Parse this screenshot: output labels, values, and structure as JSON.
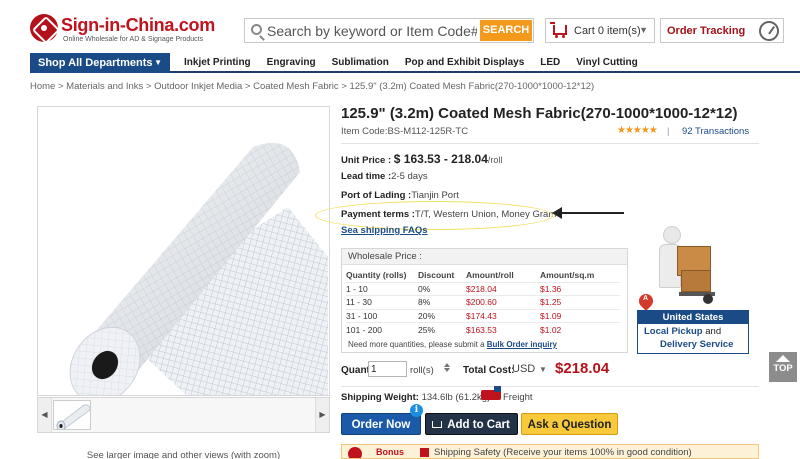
{
  "header": {
    "logo_name": "Sign-in-China.com",
    "logo_tagline": "Online Wholesale for AD & Signage Products",
    "search_placeholder": "Search by keyword or Item Code#",
    "search_button": "SEARCH",
    "cart_label": "Cart 0 item(s)",
    "order_tracking": "Order Tracking"
  },
  "nav": {
    "departments": "Shop All Departments",
    "items": [
      "Inkjet Printing",
      "Engraving",
      "Sublimation",
      "Pop and Exhibit Displays",
      "LED",
      "Vinyl Cutting"
    ]
  },
  "breadcrumb": "Home > Materials and Inks > Outdoor Inkjet Media > Coated Mesh Fabric > 125.9\" (3.2m) Coated Mesh Fabric(270-1000*1000-12*12)",
  "gallery": {
    "caption": "See larger image and other views (with zoom)"
  },
  "product": {
    "title": "125.9\" (3.2m) Coated Mesh Fabric(270-1000*1000-12*12)",
    "item_code": "Item Code:BS-M112-125R-TC",
    "rating_stars": "★★★★★",
    "separator": "|",
    "transactions": "92 Transactions",
    "unit_price_label": "Unit Price :",
    "unit_price_value": "$ 163.53 - 218.04",
    "unit_price_unit": "/roll",
    "lead_time_label": "Lead time :",
    "lead_time_value": "2-5 days",
    "port_label": "Port of Lading :",
    "port_value": "Tianjin Port",
    "payment_label": "Payment terms :",
    "payment_value": "T/T, Western Union, Money Gram",
    "shipping_faqs": "Sea shipping FAQs"
  },
  "wholesale": {
    "heading": "Wholesale Price :",
    "columns": [
      "Quantity (rolls)",
      "Discount",
      "Amount/roll",
      "Amount/sq.m"
    ],
    "rows": [
      [
        "1 - 10",
        "0%",
        "$218.04",
        "$1.36"
      ],
      [
        "11 - 30",
        "8%",
        "$200.60",
        "$1.25"
      ],
      [
        "31 - 100",
        "20%",
        "$174.43",
        "$1.09"
      ],
      [
        "101 - 200",
        "25%",
        "$163.53",
        "$1.02"
      ]
    ],
    "note": "Need more quantities, please submit a",
    "note_link": "Bulk Order inquiry"
  },
  "delivery": {
    "pin_label": "A",
    "country": "United States",
    "line1_a": "Local Pickup",
    "line1_b": "and",
    "line2": "Delivery Service"
  },
  "purchase": {
    "quantity_label": "Quantity:",
    "quantity_value": "1",
    "quantity_unit": "roll(s)",
    "total_label": "Total Cost:",
    "currency": "USD",
    "total_value": "$218.04",
    "ship_weight_label": "Shipping Weight:",
    "ship_weight_value": "134.6lb (61.2kg)",
    "freight_label": "Freight",
    "order_now": "Order Now",
    "add_to_cart": "Add to Cart",
    "ask_question": "Ask a Question",
    "info_badge": "i"
  },
  "promo": {
    "tag": "Bonus",
    "text": "Shipping Safety (Receive your items 100% in good condition)"
  },
  "top_button": "TOP",
  "colors": {
    "brand_red": "#c0131d",
    "nav_blue": "#1b4b86",
    "search_orange": "#f39a1c",
    "ask_yellow": "#f7c93b"
  }
}
